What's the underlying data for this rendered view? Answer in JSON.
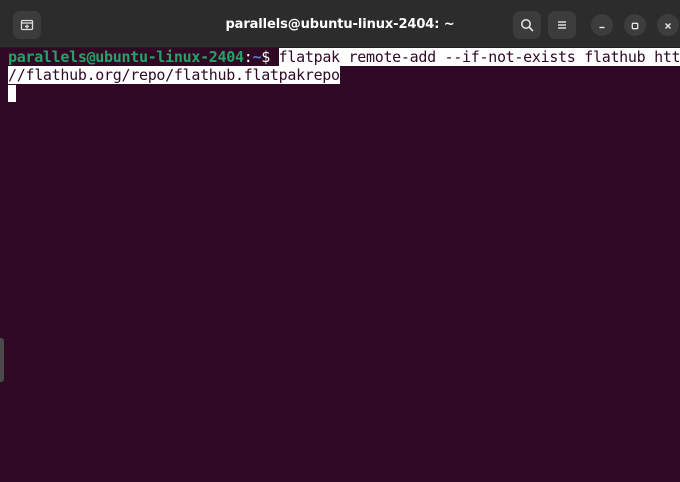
{
  "window": {
    "title": "parallels@ubuntu-linux-2404: ~"
  },
  "titlebar": {
    "icons": [
      "new-tab-icon",
      "search-icon",
      "hamburger-menu-icon",
      "minimize-icon",
      "maximize-icon",
      "close-icon"
    ]
  },
  "terminal": {
    "prompt_user": "parallels@ubuntu-linux-2404",
    "prompt_colon": ":",
    "prompt_path": "~",
    "prompt_dollar": "$ ",
    "command_line1": "flatpak remote-add --if-not-exists flathub https:",
    "command_line2": "//flathub.org/repo/flathub.flatpakrepo",
    "colors": {
      "background": "#300a24",
      "prompt_user": "#26a269",
      "prompt_path": "#5a7fd6",
      "text": "#ffffff"
    }
  }
}
